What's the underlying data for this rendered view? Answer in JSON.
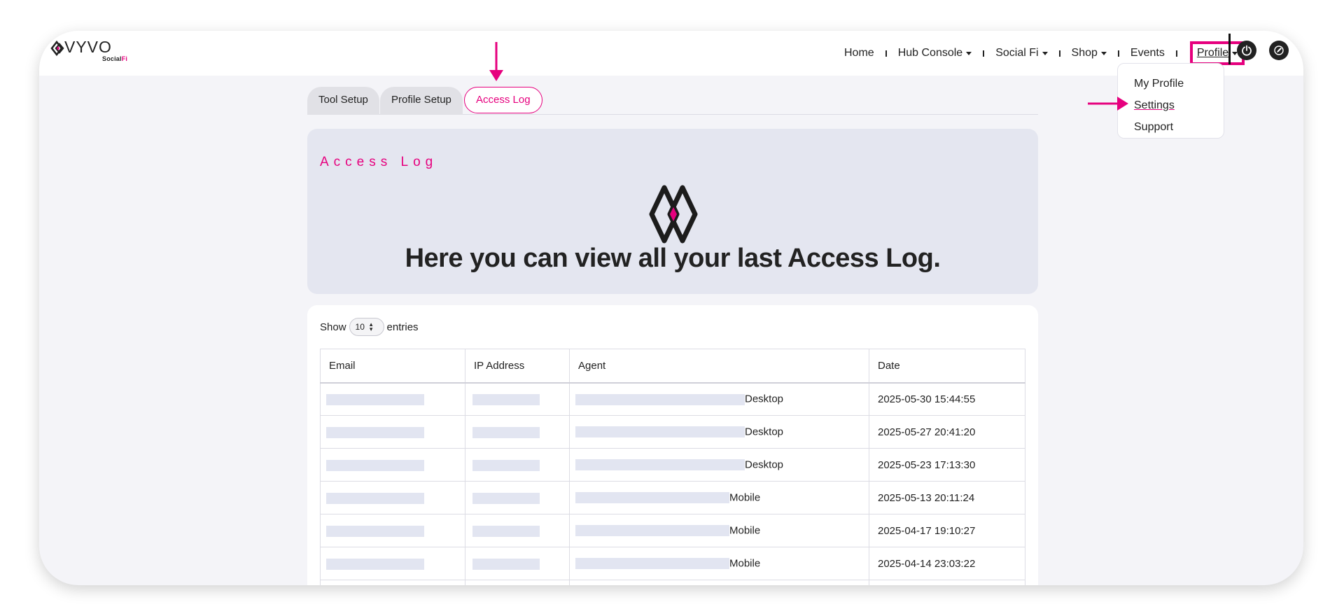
{
  "brand": {
    "name": "VYVO",
    "sub_1": "Social",
    "sub_2": "Fi"
  },
  "colors": {
    "accent": "#e6007e",
    "dark": "#222222",
    "panel": "#e4e6f0"
  },
  "nav": {
    "items": [
      {
        "label": "Home",
        "dropdown": false
      },
      {
        "label": "Hub Console",
        "dropdown": true
      },
      {
        "label": "Social Fi",
        "dropdown": true
      },
      {
        "label": "Shop",
        "dropdown": true
      },
      {
        "label": "Events",
        "dropdown": false
      }
    ],
    "profile_label": "Profile"
  },
  "profile_menu": {
    "items": [
      "My Profile",
      "Settings",
      "Support"
    ]
  },
  "tabs": [
    "Tool Setup",
    "Profile Setup",
    "Access Log"
  ],
  "active_tab": "Access Log",
  "hero": {
    "heading": "Access Log",
    "lead": "Here you can view all your last Access Log."
  },
  "table": {
    "show_label": "Show",
    "entries_value": "10",
    "entries_label": "entries",
    "columns": [
      "Email",
      "IP Address",
      "Agent",
      "Date"
    ],
    "rows": [
      {
        "agent": "Desktop",
        "date": "2025-05-30 15:44:55"
      },
      {
        "agent": "Desktop",
        "date": "2025-05-27 20:41:20"
      },
      {
        "agent": "Desktop",
        "date": "2025-05-23 17:13:30"
      },
      {
        "agent": "Mobile",
        "date": "2025-05-13 20:11:24"
      },
      {
        "agent": "Mobile",
        "date": "2025-04-17 19:10:27"
      },
      {
        "agent": "Mobile",
        "date": "2025-04-14 23:03:22"
      }
    ]
  },
  "icons": [
    "power-icon",
    "edit-icon",
    "arrow-down-icon",
    "arrow-right-icon",
    "sort-icon"
  ]
}
